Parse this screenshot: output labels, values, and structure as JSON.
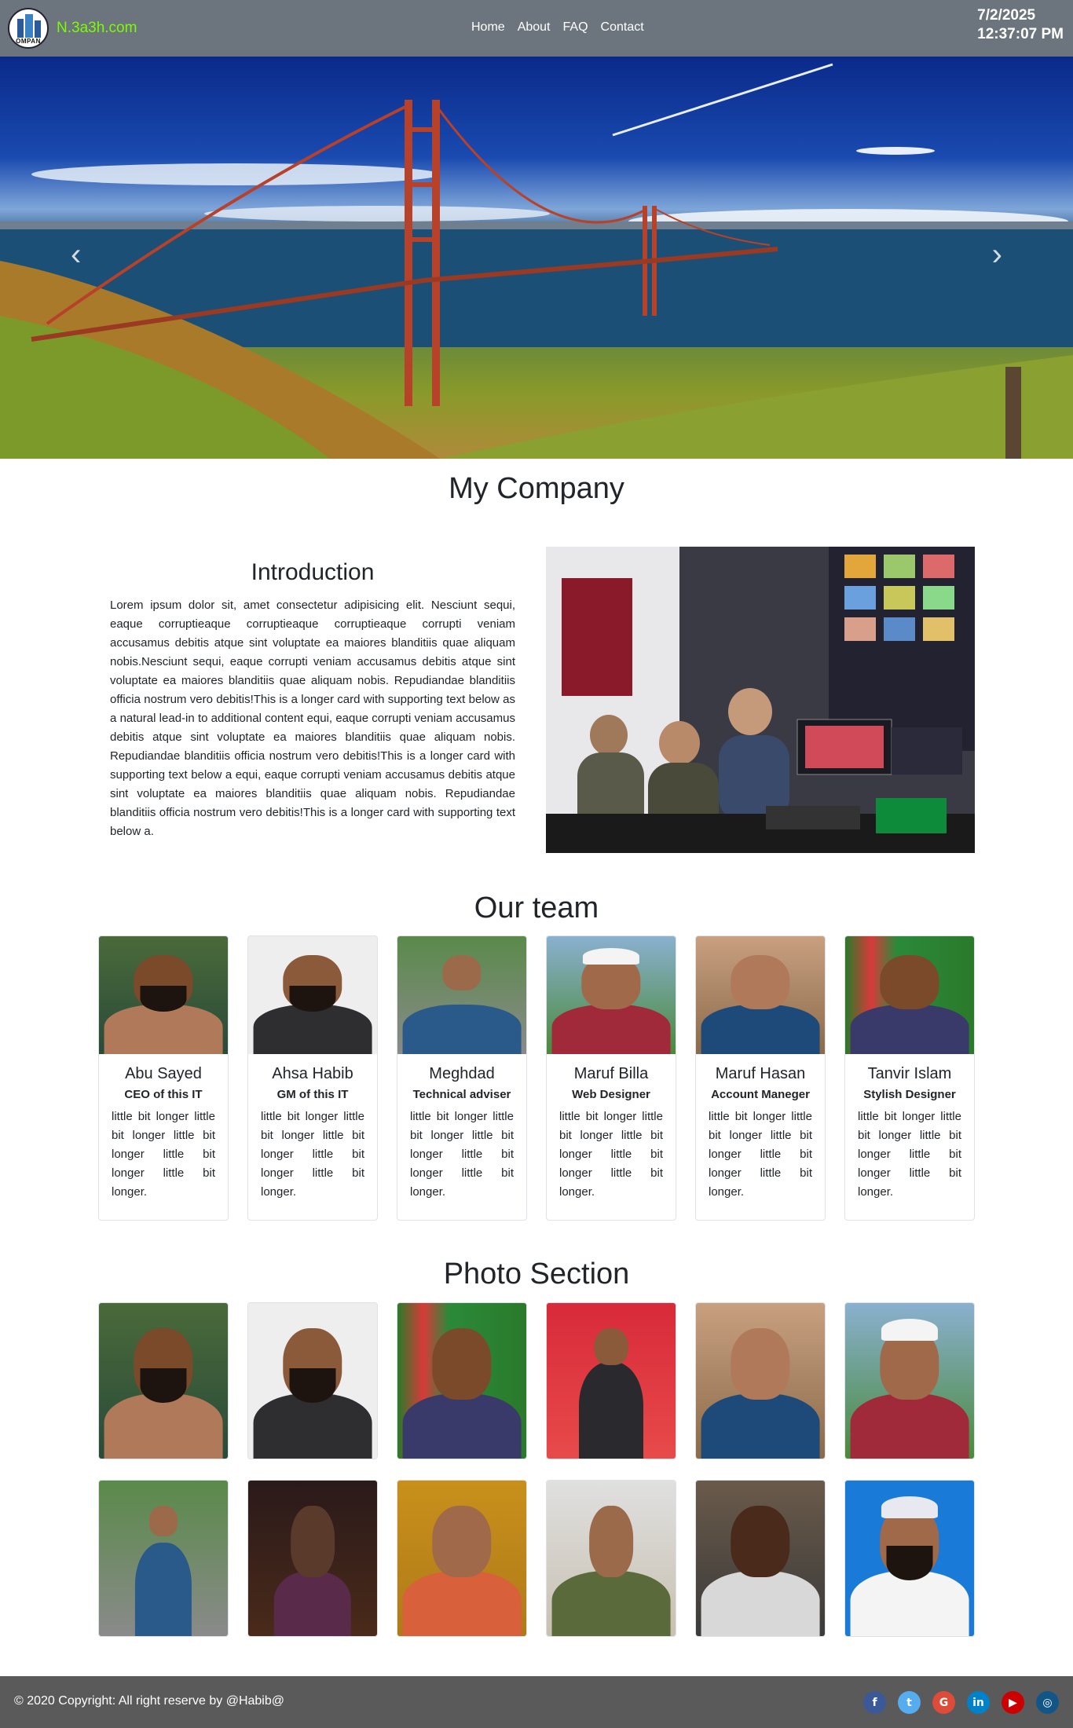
{
  "navbar": {
    "brand": {
      "logo_text": "OMPAN",
      "name": "N.3a3h.com"
    },
    "links": [
      "Home",
      "About",
      "FAQ",
      "Contact"
    ],
    "clock": {
      "date": "7/2/2025",
      "time": "12:37:07 PM"
    }
  },
  "hero": {
    "prev_icon": "chevron-left-icon",
    "next_icon": "chevron-right-icon"
  },
  "company": {
    "title": "My Company"
  },
  "intro": {
    "title": "Introduction",
    "text": "Lorem ipsum dolor sit, amet consectetur adipisicing elit. Nesciunt sequi, eaque corruptieaque corruptieaque corruptieaque corrupti veniam accusamus debitis atque sint voluptate ea maiores blanditiis quae aliquam nobis.Nesciunt sequi, eaque corrupti veniam accusamus debitis atque sint voluptate ea maiores blanditiis quae aliquam nobis. Repudiandae blanditiis officia nostrum vero debitis!This is a longer card with supporting text below as a natural lead-in to additional content equi, eaque corrupti veniam accusamus debitis atque sint voluptate ea maiores blanditiis quae aliquam nobis. Repudiandae blanditiis officia nostrum vero debitis!This is a longer card with supporting text below a equi, eaque corrupti veniam accusamus debitis atque sint voluptate ea maiores blanditiis quae aliquam nobis. Repudiandae blanditiis officia nostrum vero debitis!This is a longer card with supporting text below a."
  },
  "team": {
    "title": "Our team",
    "members": [
      {
        "name": "Abu Sayed",
        "role": "CEO of this IT",
        "desc": "little bit longer little bit longer little bit longer little bit longer little bit longer."
      },
      {
        "name": "Ahsa Habib",
        "role": "GM of this IT",
        "desc": "little bit longer little bit longer little bit longer little bit longer little bit longer."
      },
      {
        "name": "Meghdad",
        "role": "Technical adviser",
        "desc": "little bit longer little bit longer little bit longer little bit longer little bit longer."
      },
      {
        "name": "Maruf Billa",
        "role": "Web Designer",
        "desc": "little bit longer little bit longer little bit longer little bit longer little bit longer."
      },
      {
        "name": "Maruf Hasan",
        "role": "Account Maneger",
        "desc": "little bit longer little bit longer little bit longer little bit longer little bit longer."
      },
      {
        "name": "Tanvir Islam",
        "role": "Stylish Designer",
        "desc": "little bit longer little bit longer little bit longer little bit longer little bit longer."
      }
    ]
  },
  "photos": {
    "title": "Photo Section"
  },
  "footer": {
    "copyright": "© 2020 Copyright: All right reserve by @Habib@",
    "socials": [
      {
        "icon": "facebook-icon",
        "glyph": "f",
        "color": "#3b5998"
      },
      {
        "icon": "twitter-icon",
        "glyph": "t",
        "color": "#55acee"
      },
      {
        "icon": "google-icon",
        "glyph": "G",
        "color": "#dd4b39"
      },
      {
        "icon": "linkedin-icon",
        "glyph": "in",
        "color": "#0082ca"
      },
      {
        "icon": "youtube-icon",
        "glyph": "▶",
        "color": "#cc0000"
      },
      {
        "icon": "instagram-icon",
        "glyph": "◎",
        "color": "#125688"
      }
    ]
  }
}
